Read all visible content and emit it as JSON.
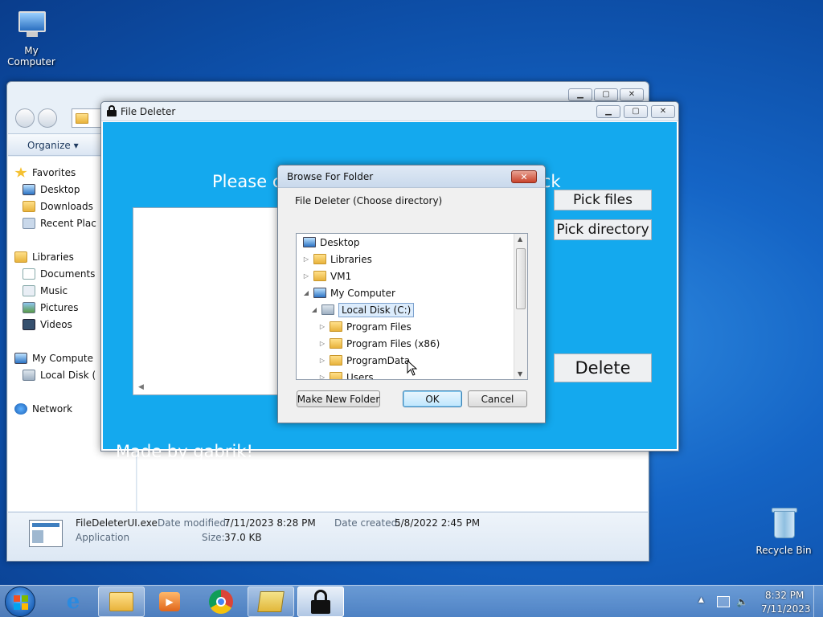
{
  "desktop": {
    "icons": [
      {
        "label": "My Computer"
      },
      {
        "label": "Recycle Bin"
      }
    ]
  },
  "explorer": {
    "toolbar": {
      "organize": "Organize ▾"
    },
    "nav": {
      "favorites": "Favorites",
      "desktop": "Desktop",
      "downloads": "Downloads",
      "recent": "Recent Plac",
      "libraries": "Libraries",
      "documents": "Documents",
      "music": "Music",
      "pictures": "Pictures",
      "videos": "Videos",
      "computer": "My Compute",
      "local_disk": "Local Disk (",
      "network": "Network"
    },
    "details": {
      "filename": "FileDeleterUI.exe",
      "type": "Application",
      "modified_label": "Date modified:",
      "modified_value": "7/11/2023 8:28 PM",
      "created_label": "Date created:",
      "created_value": "5/8/2022 2:45 PM",
      "size_label": "Size:",
      "size_value": "37.0 KB"
    }
  },
  "file_deleter": {
    "title": "File Deleter",
    "prompt": "Please choose the file\\directory to unlock",
    "pick_files": "Pick files",
    "pick_directory": "Pick directory",
    "delete": "Delete",
    "footer": "Made by gabrik!",
    "colors": {
      "body": "#14a9ee"
    }
  },
  "browse_dialog": {
    "title": "Browse For Folder",
    "description": "File Deleter (Choose directory)",
    "close": "✕",
    "tree": [
      {
        "label": "Desktop",
        "icon": "monitor-icon",
        "expander": ""
      },
      {
        "label": "Libraries",
        "icon": "folder-icon",
        "expander": "▷"
      },
      {
        "label": "VM1",
        "icon": "folder-icon",
        "expander": "▷"
      },
      {
        "label": "My Computer",
        "icon": "computer-icon",
        "expander": "◢"
      },
      {
        "label": "Local Disk (C:)",
        "icon": "disk-icon",
        "expander": "◢"
      },
      {
        "label": "Program Files",
        "icon": "folder-icon",
        "expander": "▷"
      },
      {
        "label": "Program Files (x86)",
        "icon": "folder-icon",
        "expander": "▷"
      },
      {
        "label": "ProgramData",
        "icon": "folder-icon",
        "expander": "▷"
      },
      {
        "label": "Users",
        "icon": "folder-icon",
        "expander": "▷"
      }
    ],
    "make_new_folder": "Make New Folder",
    "ok": "OK",
    "cancel": "Cancel"
  },
  "taskbar": {
    "time": "8:32 PM",
    "date": "7/11/2023",
    "tray_expand": "▲"
  }
}
